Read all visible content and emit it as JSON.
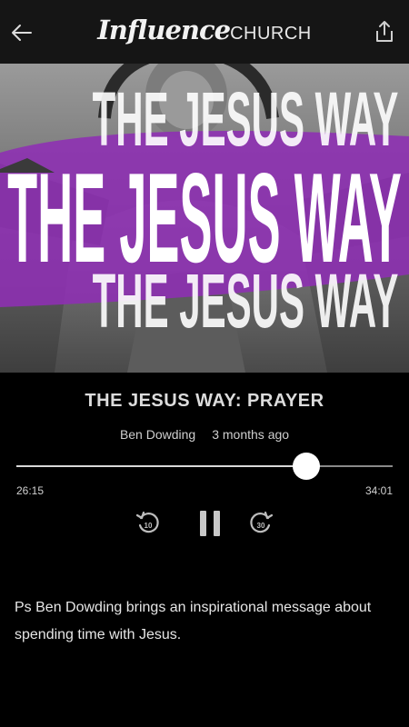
{
  "header": {
    "logo_script": "Influence",
    "logo_church": "CHURCH",
    "back_icon": "arrow-left-icon",
    "share_icon": "share-upload-icon"
  },
  "artwork": {
    "banner_text": "THE JESUS WAY",
    "accent_color": "#8e2fb4"
  },
  "episode": {
    "title": "THE JESUS WAY: PRAYER",
    "speaker": "Ben Dowding",
    "posted": "3 months ago",
    "description": "Ps Ben Dowding brings an inspirational message about spending time with Jesus."
  },
  "player": {
    "current_time": "26:15",
    "total_time": "34:01",
    "progress_fraction": 0.7717,
    "rewind_seconds": "10",
    "forward_seconds": "30",
    "state": "playing"
  }
}
